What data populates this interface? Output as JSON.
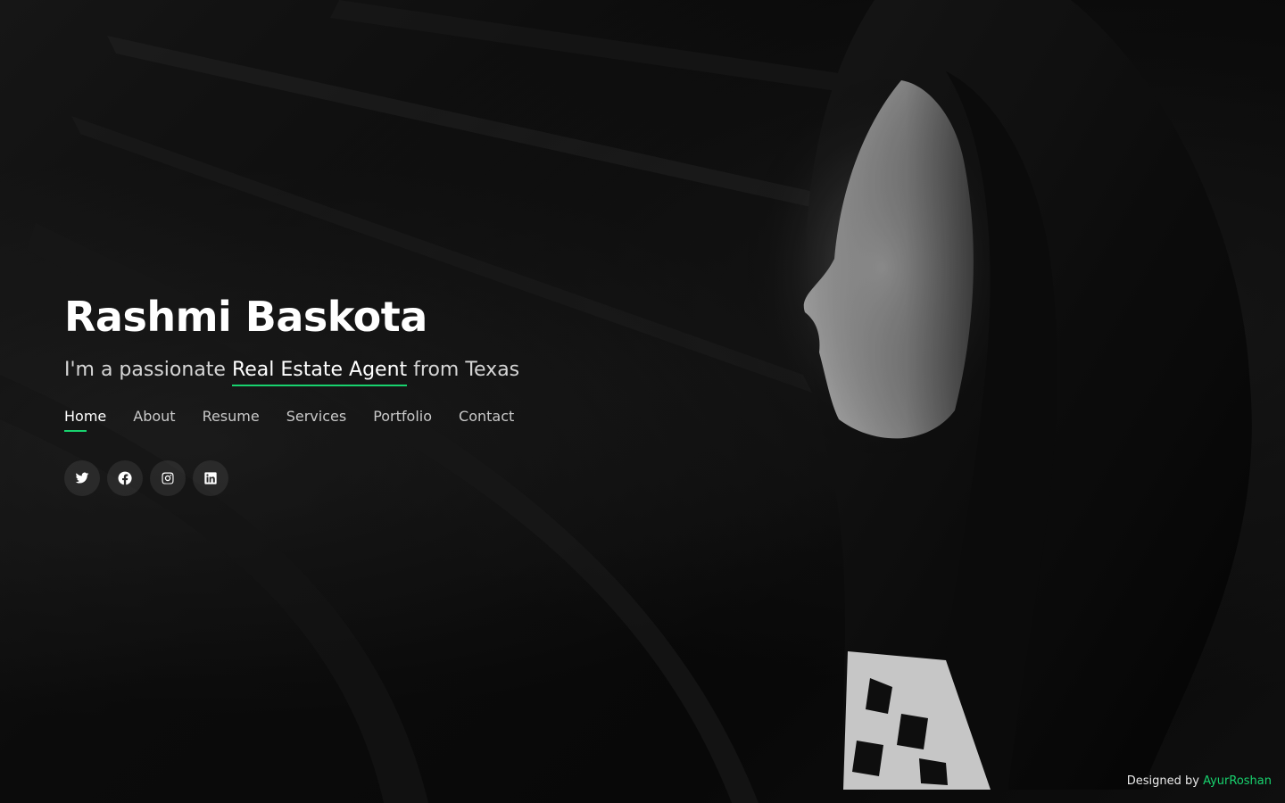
{
  "hero": {
    "name": "Rashmi Baskota",
    "tagline": {
      "prefix": "I'm a passionate ",
      "role": "Real Estate Agent",
      "suffix": " from Texas"
    }
  },
  "nav": {
    "items": [
      {
        "label": "Home",
        "active": true
      },
      {
        "label": "About",
        "active": false
      },
      {
        "label": "Resume",
        "active": false
      },
      {
        "label": "Services",
        "active": false
      },
      {
        "label": "Portfolio",
        "active": false
      },
      {
        "label": "Contact",
        "active": false
      }
    ]
  },
  "social": {
    "icons": [
      "twitter-icon",
      "facebook-icon",
      "instagram-icon",
      "linkedin-icon"
    ]
  },
  "footer": {
    "prefix": "Designed by ",
    "designer": "AyurRoshan"
  },
  "colors": {
    "accent": "#18d26e",
    "background": "#0b0b0b",
    "text": "#ffffff",
    "muted_text": "#c9c9c9"
  }
}
